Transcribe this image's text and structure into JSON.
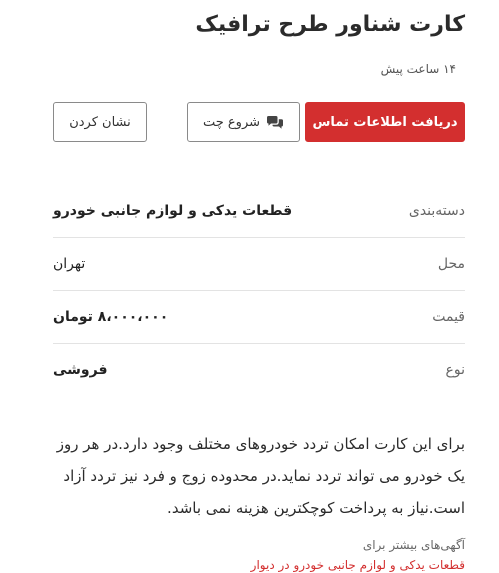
{
  "post": {
    "title": "کارت شناور طرح ترافیک",
    "time_ago": "۱۴ ساعت پیش"
  },
  "actions": {
    "contact_label": "دریافت اطلاعات تماس",
    "chat_label": "شروع چت",
    "bookmark_label": "نشان کردن",
    "contact_color": "#d32f2f"
  },
  "details": [
    {
      "label": "دسته‌بندی",
      "value": "قطعات یدکی و لوازم جانبی خودرو"
    },
    {
      "label": "محل",
      "value": "تهران"
    },
    {
      "label": "قیمت",
      "value": "۸،۰۰۰،۰۰۰ تومان"
    },
    {
      "label": "نوع",
      "value": "فروشی"
    }
  ],
  "description": "برای این کارت امکان تردد خودروهای مختلف وجود دارد.در هر روز یک خودرو می تواند تردد نماید.در محدوده زوج و فرد نیز تردد آزاد است.نیاز به پرداخت کوچکترین هزینه نمی باشد.",
  "more": {
    "label": "آگهی‌های بیشتر برای",
    "link": "قطعات یدکی و لوازم جانبی خودرو در دیوار"
  },
  "icons": {
    "chat": "chat-bubbles-icon"
  }
}
